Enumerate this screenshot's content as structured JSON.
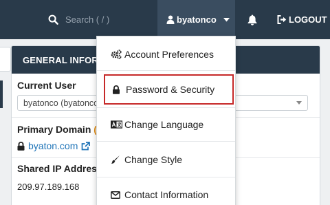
{
  "topbar": {
    "search_placeholder": "Search ( / )",
    "username": "byatonco",
    "logout_label": "LOGOUT"
  },
  "panel": {
    "title": "GENERAL INFORMATION",
    "current_user_label": "Current User",
    "current_user_value": "byatonco (byatonco)",
    "primary_domain_label": "Primary Domain",
    "primary_domain_value": "byaton.com",
    "shared_ip_label": "Shared IP Address",
    "shared_ip_value": "209.97.189.168"
  },
  "dropdown": {
    "items": [
      {
        "label": "Account Preferences",
        "icon": "gears-icon"
      },
      {
        "label": "Password & Security",
        "icon": "lock-icon"
      },
      {
        "label": "Change Language",
        "icon": "language-icon"
      },
      {
        "label": "Change Style",
        "icon": "brush-icon"
      },
      {
        "label": "Contact Information",
        "icon": "envelope-icon"
      }
    ]
  },
  "colors": {
    "topbar": "#293a4a",
    "user_menu_active": "#3a4d60",
    "highlight_border": "#c62828",
    "link": "#1f74b8"
  }
}
